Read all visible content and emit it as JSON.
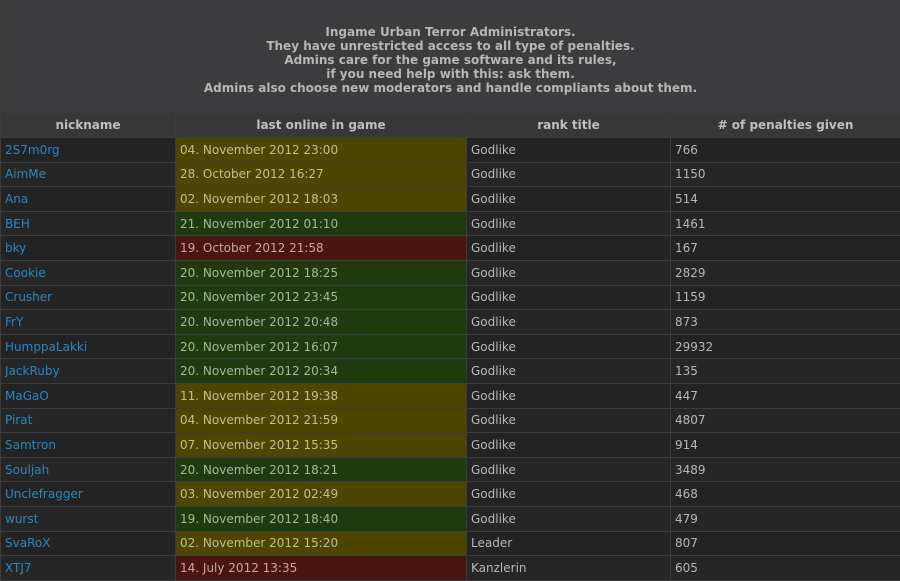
{
  "intro": {
    "lines": [
      "Ingame Urban Terror Administrators.",
      "They have unrestricted access to all type of penalties.",
      "Admins care for the game software and its rules,",
      "if you need help with this: ask them.",
      "Admins also choose new moderators and handle compliants about them."
    ]
  },
  "columns": {
    "nickname": "nickname",
    "last_online": "last online in game",
    "rank": "rank title",
    "penalties": "# of penalties given"
  },
  "status_colors": {
    "yellow": "#4d4500",
    "green": "#1e3b10",
    "red": "#4a1511"
  },
  "link_color": "#2a86c4",
  "rows": [
    {
      "nickname": "2S7m0rg",
      "last_online": "04. November 2012 23:00",
      "status": "yellow",
      "rank": "Godlike",
      "penalties": "766"
    },
    {
      "nickname": "AimMe",
      "last_online": "28. October 2012 16:27",
      "status": "yellow",
      "rank": "Godlike",
      "penalties": "1150"
    },
    {
      "nickname": "Ana",
      "last_online": "02. November 2012 18:03",
      "status": "yellow",
      "rank": "Godlike",
      "penalties": "514"
    },
    {
      "nickname": "BEH",
      "last_online": "21. November 2012 01:10",
      "status": "green",
      "rank": "Godlike",
      "penalties": "1461"
    },
    {
      "nickname": "bky",
      "last_online": "19. October 2012 21:58",
      "status": "red",
      "rank": "Godlike",
      "penalties": "167"
    },
    {
      "nickname": "Cookie",
      "last_online": "20. November 2012 18:25",
      "status": "green",
      "rank": "Godlike",
      "penalties": "2829"
    },
    {
      "nickname": "Crusher",
      "last_online": "20. November 2012 23:45",
      "status": "green",
      "rank": "Godlike",
      "penalties": "1159"
    },
    {
      "nickname": "FrY",
      "last_online": "20. November 2012 20:48",
      "status": "green",
      "rank": "Godlike",
      "penalties": "873"
    },
    {
      "nickname": "HumppaLakki",
      "last_online": "20. November 2012 16:07",
      "status": "green",
      "rank": "Godlike",
      "penalties": "29932"
    },
    {
      "nickname": "JackRuby",
      "last_online": "20. November 2012 20:34",
      "status": "green",
      "rank": "Godlike",
      "penalties": "135"
    },
    {
      "nickname": "MaGaO",
      "last_online": "11. November 2012 19:38",
      "status": "yellow",
      "rank": "Godlike",
      "penalties": "447"
    },
    {
      "nickname": "Pirat",
      "last_online": "04. November 2012 21:59",
      "status": "yellow",
      "rank": "Godlike",
      "penalties": "4807"
    },
    {
      "nickname": "Samtron",
      "last_online": "07. November 2012 15:35",
      "status": "yellow",
      "rank": "Godlike",
      "penalties": "914"
    },
    {
      "nickname": "Souljah",
      "last_online": "20. November 2012 18:21",
      "status": "green",
      "rank": "Godlike",
      "penalties": "3489"
    },
    {
      "nickname": "Unclefragger",
      "last_online": "03. November 2012 02:49",
      "status": "yellow",
      "rank": "Godlike",
      "penalties": "468"
    },
    {
      "nickname": "wurst",
      "last_online": "19. November 2012 18:40",
      "status": "green",
      "rank": "Godlike",
      "penalties": "479"
    },
    {
      "nickname": "SvaRoX",
      "last_online": "02. November 2012 15:20",
      "status": "yellow",
      "rank": "Leader",
      "penalties": "807"
    },
    {
      "nickname": "XTJ7",
      "last_online": "14. July 2012 13:35",
      "status": "red",
      "rank": "Kanzlerin",
      "penalties": "605"
    }
  ]
}
